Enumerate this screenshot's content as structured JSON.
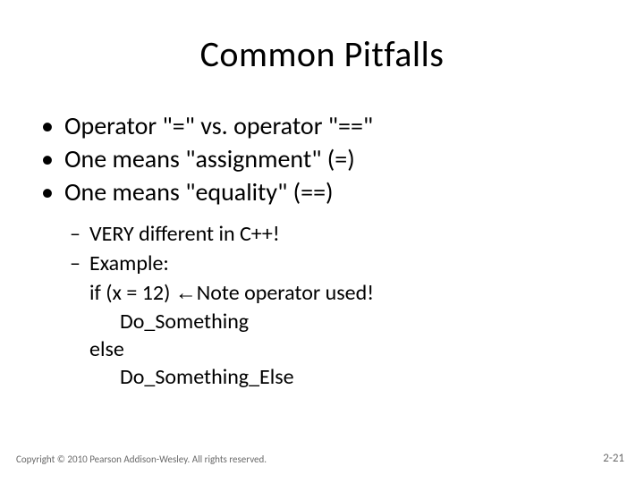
{
  "title": "Common Pitfalls",
  "bullets": [
    "Operator \"=\" vs. operator \"==\"",
    "One means \"assignment\" (=)",
    "One means \"equality\" (==)"
  ],
  "sub": [
    "VERY different in C++!",
    "Example:"
  ],
  "code": {
    "line1_pre": "if (x = 12)  ",
    "line1_arrow": "←",
    "line1_post": "Note operator used!",
    "line2": "Do_Something",
    "line3": "else",
    "line4": "Do_Something_Else"
  },
  "footer": {
    "copyright": "Copyright © 2010 Pearson Addison-Wesley. All rights reserved.",
    "page": "2-21"
  }
}
